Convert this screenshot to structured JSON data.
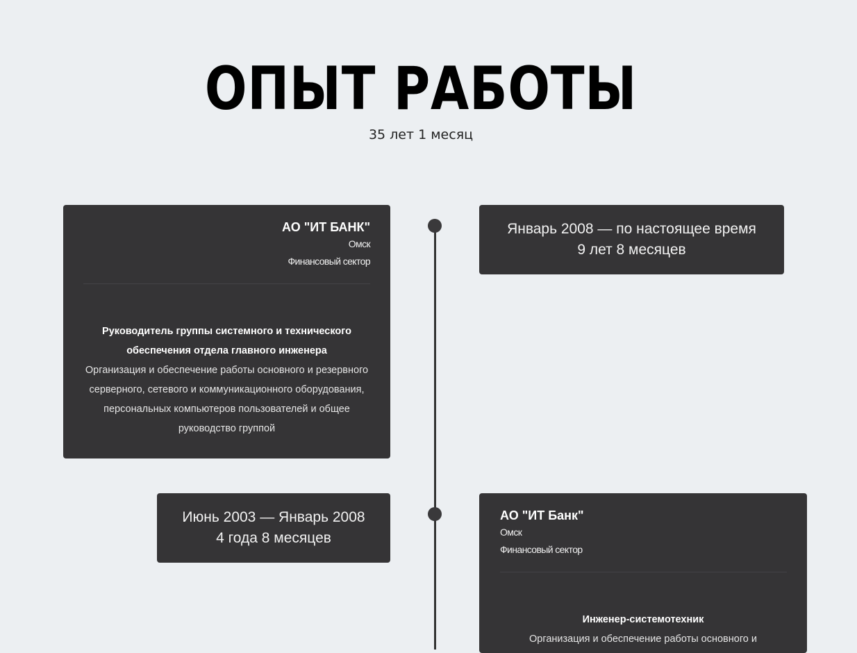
{
  "header": {
    "title": "ОПЫТ РАБОТЫ",
    "total_experience": "35 лет 1 месяц"
  },
  "jobs": [
    {
      "company": "АО \"ИТ БАНК\"",
      "city": "Омск",
      "industry": "Финансовый сектор",
      "position": "Руководитель группы системного и технического обеспечения отдела главного инженера",
      "description": "Организация и обеспечение работы основного и резервного серверного, сетевого и коммуникационного оборудования, персональных компьютеров пользователей и общее руководство группой",
      "period": "Январь 2008 — по настоящее время",
      "duration": "9 лет 8 месяцев"
    },
    {
      "company": "АО \"ИТ Банк\"",
      "city": "Омск",
      "industry": "Финансовый сектор",
      "position": "Инженер-системотехник",
      "description": "Организация и обеспечение работы основного и",
      "period": "Июнь 2003 — Январь 2008",
      "duration": "4 года 8 месяцев"
    }
  ]
}
